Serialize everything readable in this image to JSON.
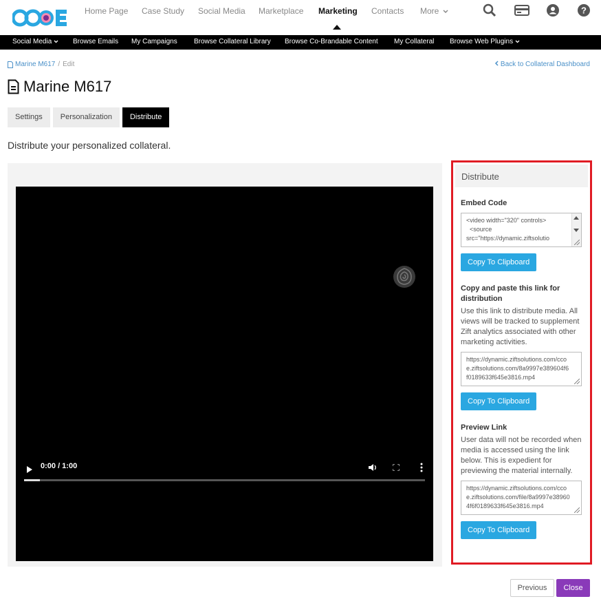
{
  "brand": {
    "logo_text": "CCoE",
    "accent": "#2aa7e1",
    "close_color": "#8a3ab9",
    "highlight": "#e01b24"
  },
  "topnav": {
    "items": [
      "Home Page",
      "Case Study",
      "Social Media",
      "Marketplace",
      "Marketing",
      "Contacts",
      "More"
    ],
    "active": "Marketing",
    "icons": [
      "search-icon",
      "card-icon",
      "user-icon",
      "help-icon"
    ]
  },
  "subnav": {
    "items": [
      "Social Media",
      "Browse Emails",
      "My Campaigns",
      "Browse Collateral Library",
      "Browse Co-Brandable Content",
      "My Collateral",
      "Browse Web Plugins"
    ]
  },
  "breadcrumb": {
    "item": "Marine M617",
    "current": "Edit"
  },
  "back_link": "Back to Collateral Dashboard",
  "page": {
    "title": "Marine M617",
    "intro": "Distribute your personalized collateral."
  },
  "tabs": [
    "Settings",
    "Personalization",
    "Distribute"
  ],
  "active_tab": "Distribute",
  "video": {
    "time": "0:00 / 1:00",
    "progress": 0.04
  },
  "distribute": {
    "heading": "Distribute",
    "embed": {
      "title": "Embed Code",
      "code": "<video width=\"320\" controls>\n  <source src=\"https://dynamic.ziftsolutio",
      "button": "Copy To Clipboard"
    },
    "link": {
      "title": "Copy and paste this link for distribution",
      "text": "Use this link to distribute media. All views will be tracked to supplement Zift analytics associated with other marketing activities.",
      "url": "https://dynamic.ziftsolutions.com/ccoe.ziftsolutions.com/8a9997e389604f6f0189633f645e3816.mp4",
      "button": "Copy To Clipboard"
    },
    "preview": {
      "title": "Preview Link",
      "text": "User data will not be recorded when media is accessed using the link below. This is expedient for previewing the material internally.",
      "url": "https://dynamic.ziftsolutions.com/ccoe.ziftsolutions.com/file/8a9997e389604f6f0189633f645e3816.mp4",
      "button": "Copy To Clipboard"
    }
  },
  "footer": {
    "previous": "Previous",
    "close": "Close"
  }
}
